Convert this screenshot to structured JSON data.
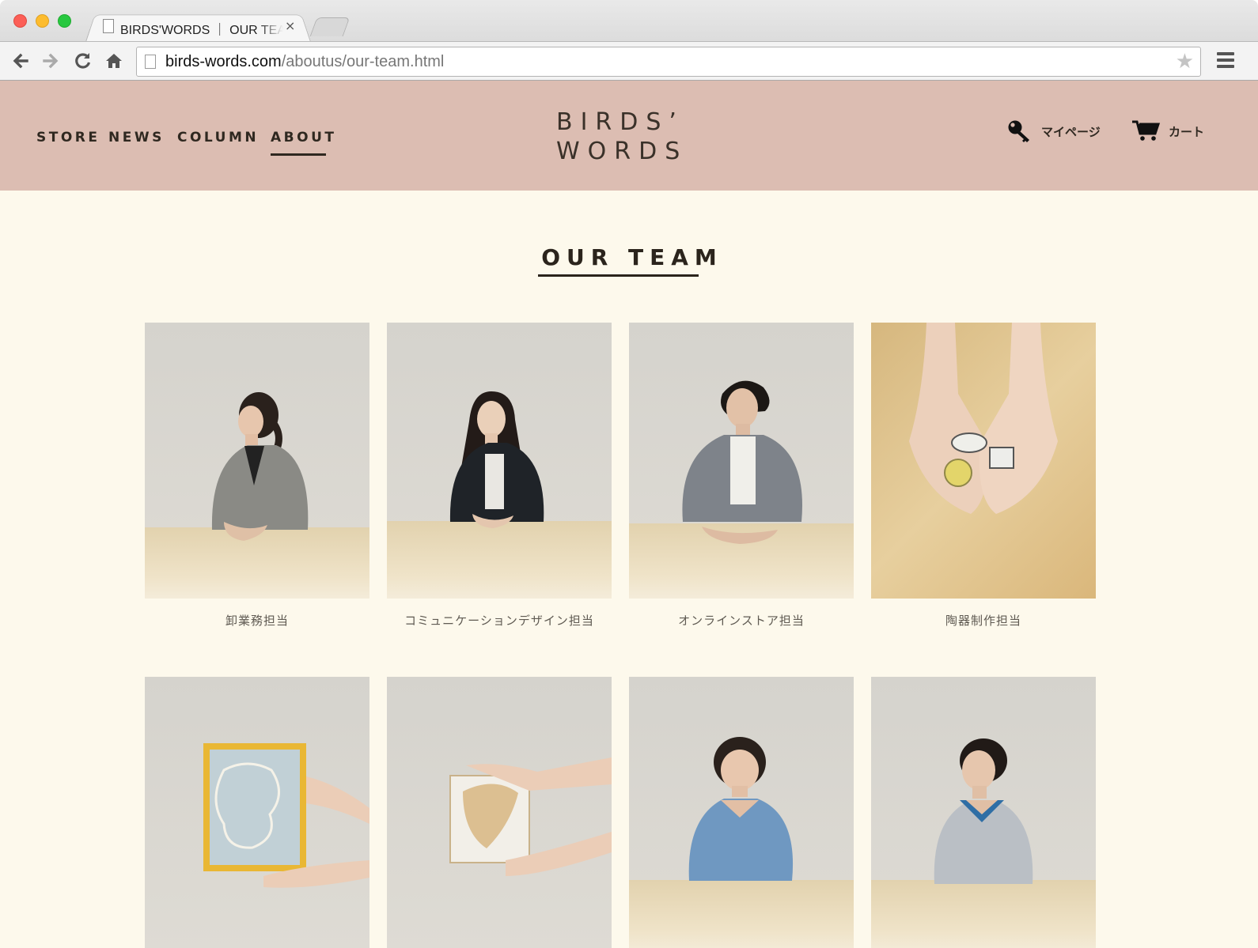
{
  "browser": {
    "tab_title": "BIRDS'WORDS ｜ OUR TEAM",
    "tab_close_glyph": "×",
    "url_host": "birds-words.com",
    "url_path": "/aboutus/our-team.html"
  },
  "header": {
    "nav": [
      {
        "label": "STORE"
      },
      {
        "label": "NEWS"
      },
      {
        "label": "COLUMN"
      },
      {
        "label": "ABOUT",
        "active": true
      }
    ],
    "logo_line1": "BIRDS’",
    "logo_line2": "WORDS",
    "mypage_label": "マイページ",
    "cart_label": "カート",
    "mypage_icon": "key-icon",
    "cart_icon": "cart-icon"
  },
  "main": {
    "title": "OUR TEAM",
    "team": [
      {
        "caption": "卸業務担当"
      },
      {
        "caption": "コミュニケーションデザイン担当"
      },
      {
        "caption": "オンラインストア担当"
      },
      {
        "caption": "陶器制作担当"
      },
      {
        "caption": ""
      },
      {
        "caption": ""
      },
      {
        "caption": ""
      },
      {
        "caption": ""
      }
    ]
  },
  "colors": {
    "header_bg": "#dcbdb2",
    "page_bg": "#fdf9ec",
    "text_dark": "#2f2820"
  }
}
